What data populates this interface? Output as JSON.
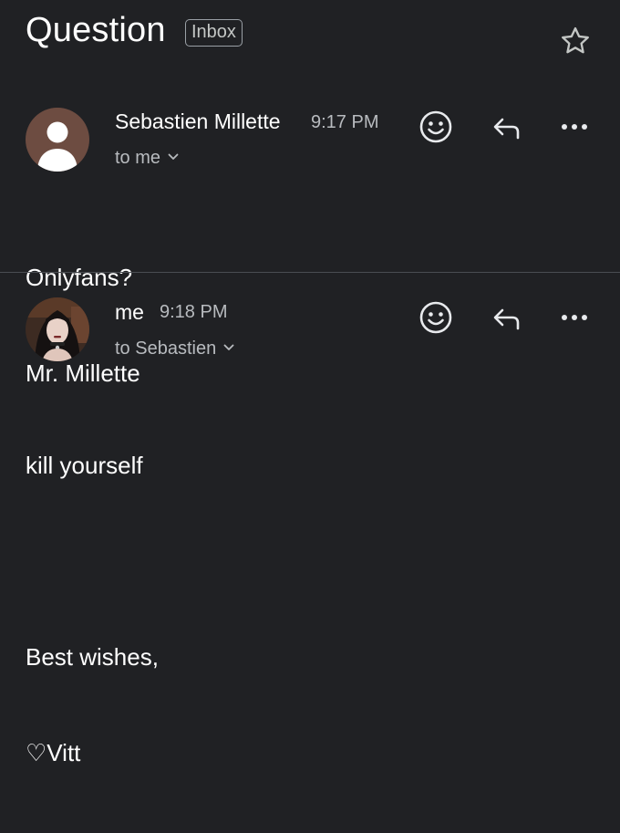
{
  "thread": {
    "subject": "Question",
    "label": "Inbox"
  },
  "messages": [
    {
      "sender": "Sebastien Millette",
      "time": "9:17 PM",
      "recipient": "to me",
      "body_lines": [
        "Onlyfans?",
        "Mr. Millette"
      ]
    },
    {
      "sender": "me",
      "time": "9:18 PM",
      "recipient": "to Sebastien",
      "body_lines": [
        "kill yourself",
        "",
        "Best wishes,",
        "♡Vitt"
      ]
    }
  ],
  "icons": {
    "star": "star-icon",
    "emoji": "emoji-reaction-icon",
    "reply": "reply-icon",
    "more": "more-options-icon",
    "expand": "chevron-down-icon"
  },
  "colors": {
    "background": "#202124",
    "primary_text": "#ffffff",
    "secondary_text": "#b8bbbf",
    "default_avatar": "#6d4c41"
  }
}
